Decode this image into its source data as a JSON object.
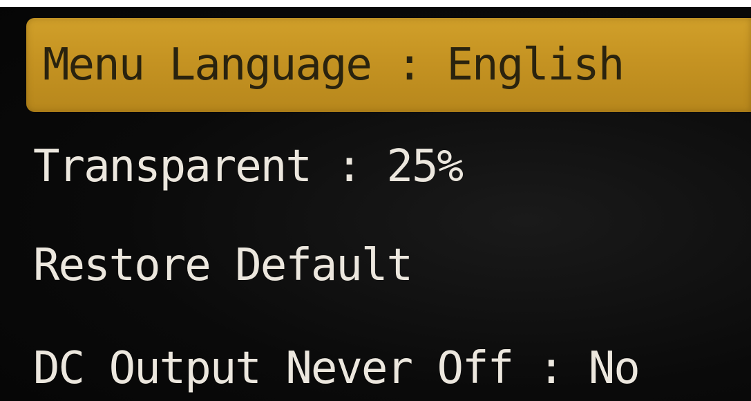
{
  "osd_menu": {
    "items": [
      {
        "label": "Menu Language : English",
        "selected": true
      },
      {
        "label": "Transparent : 25%",
        "selected": false
      },
      {
        "label": "Restore Default",
        "selected": false
      },
      {
        "label": "DC Output Never Off : No",
        "selected": false
      }
    ],
    "colors": {
      "highlight": "#c59322",
      "highlight_text": "#2a230e",
      "text": "#ece7de",
      "background": "#0a0a0a"
    }
  }
}
